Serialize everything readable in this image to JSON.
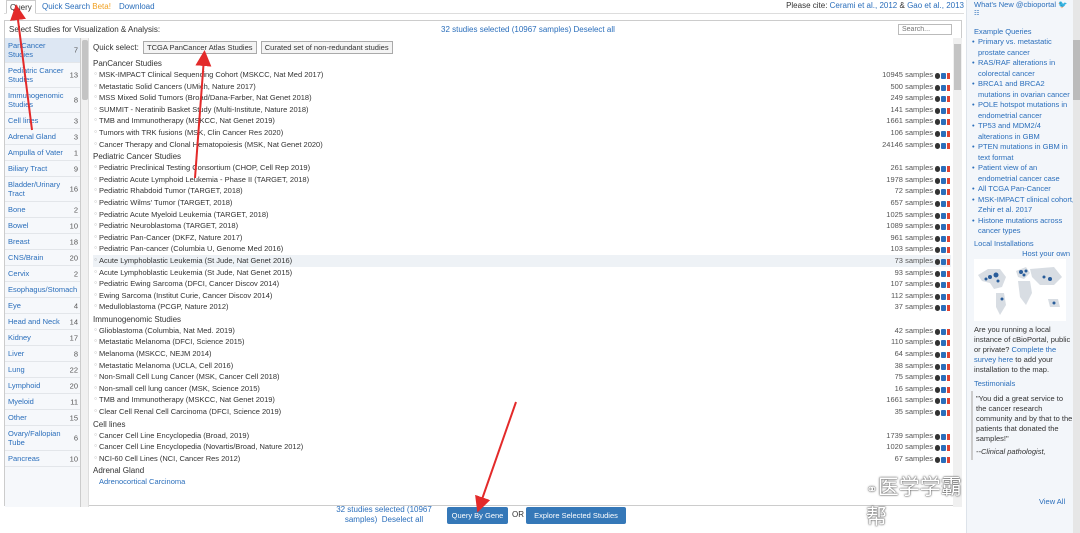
{
  "tabs": [
    {
      "label": "Query"
    },
    {
      "label": "Quick Search",
      "badge": "Beta!"
    },
    {
      "label": "Download"
    }
  ],
  "citation": {
    "prefix": "Please cite:",
    "ref1": "Cerami et al., 2012",
    "amp": "&",
    "ref2": "Gao et al., 2013"
  },
  "header": {
    "select_label": "Select Studies for Visualization & Analysis:",
    "selected_count": "32 studies selected (10967 samples)",
    "deselect_all": "Deselect all",
    "search_placeholder": "Search..."
  },
  "quick_select": {
    "label": "Quick select:",
    "buttons": [
      "TCGA PanCancer Atlas Studies",
      "Curated set of non-redundant studies"
    ]
  },
  "categories": [
    {
      "name": "PanCancer Studies",
      "count": "7"
    },
    {
      "name": "Pediatric Cancer Studies",
      "count": "13"
    },
    {
      "name": "Immunogenomic Studies",
      "count": "8"
    },
    {
      "name": "Cell lines",
      "count": "3"
    },
    {
      "name": "Adrenal Gland",
      "count": "3"
    },
    {
      "name": "Ampulla of Vater",
      "count": "1"
    },
    {
      "name": "Biliary Tract",
      "count": "9"
    },
    {
      "name": "Bladder/Urinary Tract",
      "count": "16"
    },
    {
      "name": "Bone",
      "count": "2"
    },
    {
      "name": "Bowel",
      "count": "10"
    },
    {
      "name": "Breast",
      "count": "18"
    },
    {
      "name": "CNS/Brain",
      "count": "20"
    },
    {
      "name": "Cervix",
      "count": "2"
    },
    {
      "name": "Esophagus/Stomach",
      "count": ""
    },
    {
      "name": "Eye",
      "count": "4"
    },
    {
      "name": "Head and Neck",
      "count": "14"
    },
    {
      "name": "Kidney",
      "count": "17"
    },
    {
      "name": "Liver",
      "count": "8"
    },
    {
      "name": "Lung",
      "count": "22"
    },
    {
      "name": "Lymphoid",
      "count": "20"
    },
    {
      "name": "Myeloid",
      "count": "11"
    },
    {
      "name": "Other",
      "count": "15"
    },
    {
      "name": "Ovary/Fallopian Tube",
      "count": "6"
    },
    {
      "name": "Pancreas",
      "count": "10"
    }
  ],
  "groups": [
    {
      "title": "PanCancer Studies",
      "studies": [
        {
          "name": "MSK-IMPACT Clinical Sequencing Cohort (MSKCC, Nat Med 2017)",
          "samples": "10945 samples"
        },
        {
          "name": "Metastatic Solid Cancers (UMich, Nature 2017)",
          "samples": "500 samples"
        },
        {
          "name": "MSS Mixed Solid Tumors (Broad/Dana-Farber, Nat Genet 2018)",
          "samples": "249 samples"
        },
        {
          "name": "SUMMIT - Neratinib Basket Study (Multi-Institute, Nature 2018)",
          "samples": "141 samples"
        },
        {
          "name": "TMB and Immunotherapy (MSKCC, Nat Genet 2019)",
          "samples": "1661 samples"
        },
        {
          "name": "Tumors with TRK fusions (MSK, Clin Cancer Res 2020)",
          "samples": "106 samples"
        },
        {
          "name": "Cancer Therapy and Clonal Hematopoiesis (MSK, Nat Genet 2020)",
          "samples": "24146 samples"
        }
      ]
    },
    {
      "title": "Pediatric Cancer Studies",
      "studies": [
        {
          "name": "Pediatric Preclinical Testing Consortium (CHOP, Cell Rep 2019)",
          "samples": "261 samples"
        },
        {
          "name": "Pediatric Acute Lymphoid Leukemia - Phase II (TARGET, 2018)",
          "samples": "1978 samples"
        },
        {
          "name": "Pediatric Rhabdoid Tumor (TARGET, 2018)",
          "samples": "72 samples"
        },
        {
          "name": "Pediatric Wilms' Tumor (TARGET, 2018)",
          "samples": "657 samples"
        },
        {
          "name": "Pediatric Acute Myeloid Leukemia (TARGET, 2018)",
          "samples": "1025 samples"
        },
        {
          "name": "Pediatric Neuroblastoma (TARGET, 2018)",
          "samples": "1089 samples"
        },
        {
          "name": "Pediatric Pan-Cancer (DKFZ, Nature 2017)",
          "samples": "961 samples"
        },
        {
          "name": "Pediatric Pan-cancer (Columbia U, Genome Med 2016)",
          "samples": "103 samples"
        },
        {
          "name": "Acute Lymphoblastic Leukemia (St Jude, Nat Genet 2016)",
          "samples": "73 samples"
        },
        {
          "name": "Acute Lymphoblastic Leukemia (St Jude, Nat Genet 2015)",
          "samples": "93 samples"
        },
        {
          "name": "Pediatric Ewing Sarcoma (DFCI, Cancer Discov 2014)",
          "samples": "107 samples"
        },
        {
          "name": "Ewing Sarcoma (Institut Curie, Cancer Discov 2014)",
          "samples": "112 samples"
        },
        {
          "name": "Medulloblastoma (PCGP, Nature 2012)",
          "samples": "37 samples"
        }
      ]
    },
    {
      "title": "Immunogenomic Studies",
      "studies": [
        {
          "name": "Glioblastoma (Columbia, Nat Med. 2019)",
          "samples": "42 samples"
        },
        {
          "name": "Metastatic Melanoma (DFCI, Science 2015)",
          "samples": "110 samples"
        },
        {
          "name": "Melanoma (MSKCC, NEJM 2014)",
          "samples": "64 samples"
        },
        {
          "name": "Metastatic Melanoma (UCLA, Cell 2016)",
          "samples": "38 samples"
        },
        {
          "name": "Non-Small Cell Lung Cancer (MSK, Cancer Cell 2018)",
          "samples": "75 samples"
        },
        {
          "name": "Non-small cell lung cancer (MSK, Science 2015)",
          "samples": "16 samples"
        },
        {
          "name": "TMB and Immunotherapy (MSKCC, Nat Genet 2019)",
          "samples": "1661 samples"
        },
        {
          "name": "Clear Cell Renal Cell Carcinoma (DFCI, Science 2019)",
          "samples": "35 samples"
        }
      ]
    },
    {
      "title": "Cell lines",
      "studies": [
        {
          "name": "Cancer Cell Line Encyclopedia (Broad, 2019)",
          "samples": "1739 samples"
        },
        {
          "name": "Cancer Cell Line Encyclopedia (Novartis/Broad, Nature 2012)",
          "samples": "1020 samples"
        },
        {
          "name": "NCI-60 Cell Lines (NCI, Cancer Res 2012)",
          "samples": "67 samples"
        }
      ]
    },
    {
      "title": "Adrenal Gland",
      "link": "Adrenocortical Carcinoma",
      "studies": []
    }
  ],
  "bottom": {
    "count_line1": "32 studies selected (10967",
    "count_line2": "samples)",
    "deselect_all": "Deselect all",
    "query_button": "Query By Gene",
    "or": "OR",
    "explore_button": "Explore Selected Studies"
  },
  "sidebar": {
    "whats_new": "What's New",
    "handle": "@cbioportal",
    "example_queries": "Example Queries",
    "examples": [
      "Primary vs. metastatic prostate cancer",
      "RAS/RAF alterations in colorectal cancer",
      "BRCA1 and BRCA2 mutations in ovarian cancer",
      "POLE hotspot mutations in endometrial cancer",
      "TP53 and MDM2/4 alterations in GBM",
      "PTEN mutations in GBM in text format",
      "Patient view of an endometrial cancer case",
      "All TCGA Pan-Cancer",
      "MSK-IMPACT clinical cohort, Zehir et al. 2017",
      "Histone mutations across cancer types"
    ],
    "local_installations": "Local Installations",
    "host_your_own": "Host your own",
    "running_text": "Are you running a local instance of cBioPortal, public or private?",
    "complete_survey": "Complete the survey here",
    "survey_tail": "to add your installation to the map.",
    "testimonials": "Testimonials",
    "quote": "\"You did a great service to the cancer research community and by that to the patients that donated the samples!\"",
    "quote_author": "--Clinical pathologist,",
    "view_all": "View All"
  },
  "watermark": "医学学霸帮"
}
